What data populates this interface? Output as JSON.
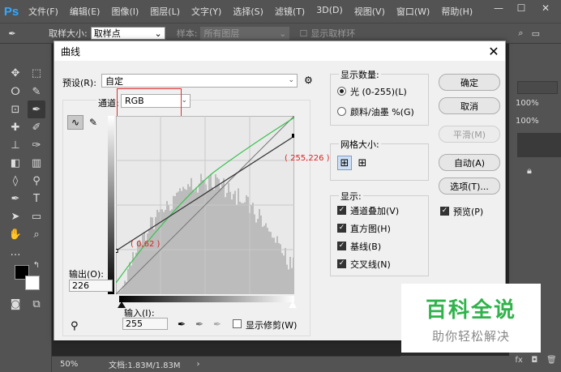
{
  "app": {
    "logo": "Ps"
  },
  "menu": [
    "文件(F)",
    "编辑(E)",
    "图像(I)",
    "图层(L)",
    "文字(Y)",
    "选择(S)",
    "滤镜(T)",
    "3D(D)",
    "视图(V)",
    "窗口(W)",
    "帮助(H)"
  ],
  "options": {
    "sample_size_label": "取样大小:",
    "sample_size_value": "取样点",
    "sample_label": "样本:",
    "sample_value": "所有图层",
    "show_ring": "显示取样环"
  },
  "panel": {
    "opacity1": "100%",
    "opacity2": "100%"
  },
  "status": {
    "zoom": "50%",
    "doc": "文档:1.83M/1.83M"
  },
  "dialog": {
    "title": "曲线",
    "preset_label": "预设(R):",
    "preset_value": "自定",
    "channel_label": "通道:",
    "channel_value": "RGB",
    "output_label": "输出(O):",
    "output_value": "226",
    "input_label": "输入(I):",
    "input_value": "255",
    "show_clipping": "显示修剪(W)",
    "point_label_high": "( 255,226 )",
    "point_label_low": "( 0,62 )",
    "display_amount": {
      "title": "显示数量:",
      "light": "光 (0-255)(L)",
      "pigment": "颜料/油墨 %(G)"
    },
    "grid_size": {
      "title": "网格大小:"
    },
    "show": {
      "title": "显示:",
      "channel_overlay": "通道叠加(V)",
      "histogram": "直方图(H)",
      "baseline": "基线(B)",
      "intersection": "交叉线(N)"
    },
    "buttons": {
      "ok": "确定",
      "cancel": "取消",
      "smooth": "平滑(M)",
      "auto": "自动(A)",
      "options": "选项(T)...",
      "preview": "预览(P)"
    },
    "curve": {
      "points": [
        [
          0,
          62
        ],
        [
          255,
          226
        ]
      ],
      "range": [
        0,
        255
      ]
    }
  },
  "watermark": {
    "title": "百科全说",
    "subtitle": "助你轻松解决"
  },
  "colors": {
    "accent_green": "#2fb34a",
    "ps_blue": "#31a8ff",
    "point_label_red": "#e02020"
  }
}
